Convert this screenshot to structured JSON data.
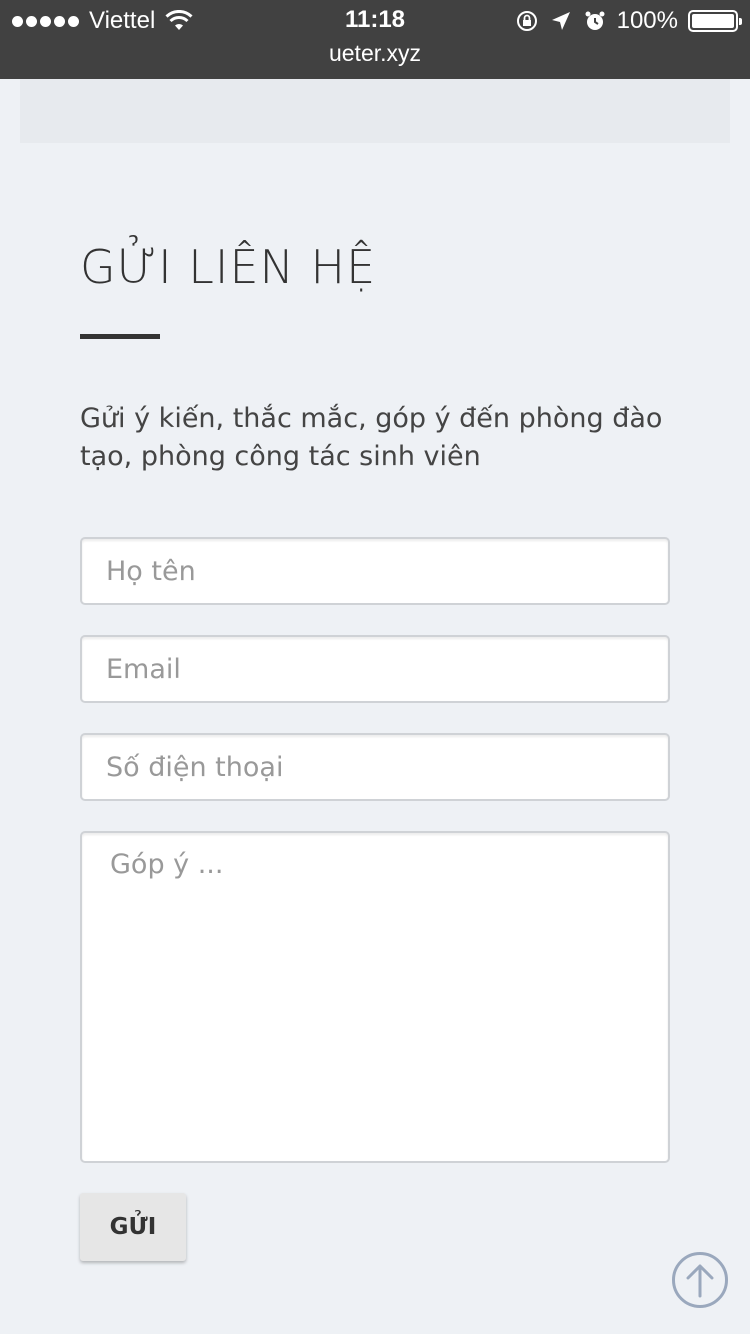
{
  "status_bar": {
    "carrier": "Viettel",
    "time": "11:18",
    "battery": "100%",
    "url": "ueter.xyz",
    "icons": [
      "signal-dots",
      "wifi-icon",
      "orientation-lock-icon",
      "location-arrow-icon",
      "alarm-icon",
      "battery-icon"
    ]
  },
  "contact": {
    "title": "GỬI LIÊN HỆ",
    "description": "Gửi ý kiến, thắc mắc, góp ý đến phòng đào tạo, phòng công tác sinh viên",
    "fields": {
      "name_placeholder": "Họ tên",
      "email_placeholder": "Email",
      "phone_placeholder": "Số điện thoại",
      "message_placeholder": "Góp ý ..."
    },
    "submit_label": "GỬI"
  },
  "colors": {
    "page_bg": "#eef1f5",
    "status_bar_bg": "#414141",
    "heading": "#333333",
    "scroll_top_border": "#9aa8bd"
  }
}
